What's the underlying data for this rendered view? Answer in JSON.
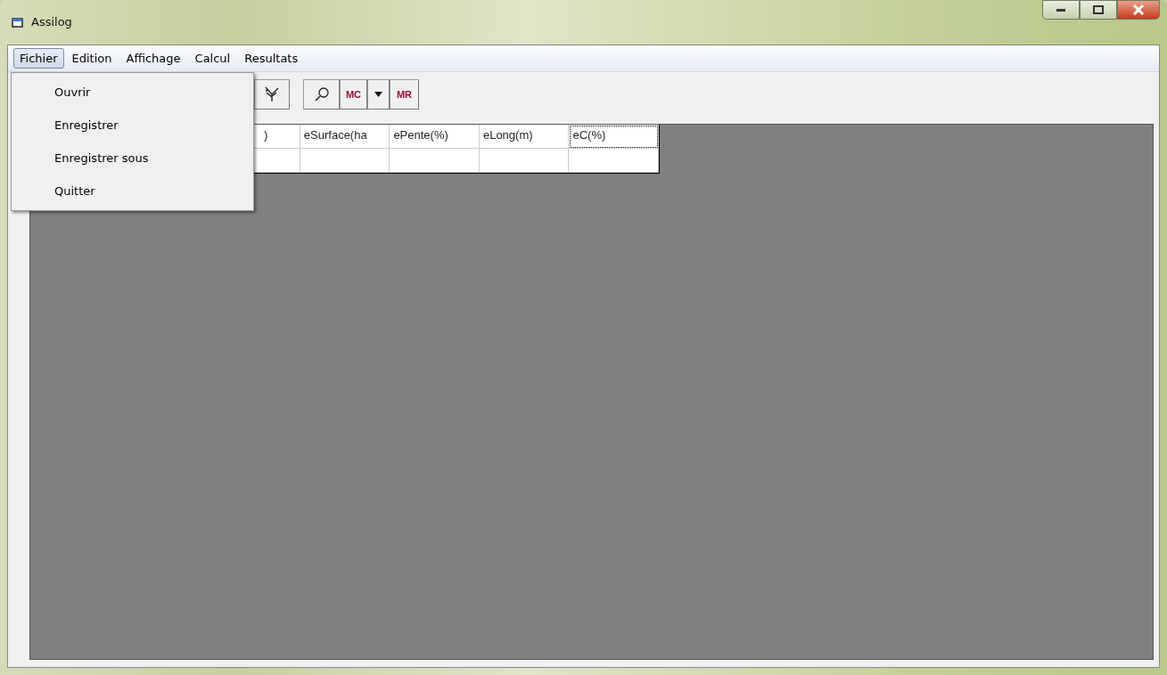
{
  "window": {
    "title": "Assilog"
  },
  "menu_bar": [
    {
      "label": "Fichier",
      "selected": true
    },
    {
      "label": "Edition",
      "selected": false
    },
    {
      "label": "Affichage",
      "selected": false
    },
    {
      "label": "Calcul",
      "selected": false
    },
    {
      "label": "Resultats",
      "selected": false
    }
  ],
  "dropdown_menu": [
    {
      "label": "Ouvrir"
    },
    {
      "label": "Enregistrer"
    },
    {
      "label": "Enregistrer sous"
    },
    {
      "label": "Quitter"
    }
  ],
  "toolbar": [
    {
      "kind": "tree"
    },
    {
      "kind": "zoom"
    },
    {
      "kind": "text",
      "label": "MC"
    },
    {
      "kind": "caret"
    },
    {
      "kind": "text",
      "label": "MR"
    }
  ],
  "table": {
    "columns": [
      {
        "label": ")",
        "focused": false
      },
      {
        "label": "eSurface(ha",
        "focused": false
      },
      {
        "label": "ePente(%)",
        "focused": false
      },
      {
        "label": "eLong(m)",
        "focused": false
      },
      {
        "label": "eC(%)",
        "focused": true
      }
    ]
  }
}
